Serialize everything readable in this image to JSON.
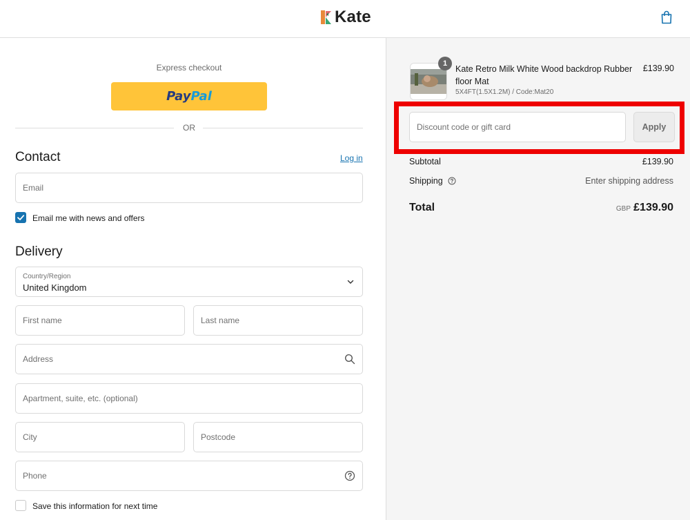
{
  "header": {
    "logo_text": "Kate",
    "cart_icon": "shopping-bag-icon"
  },
  "express": {
    "label": "Express checkout",
    "paypal_part1": "Pay",
    "paypal_part2": "Pal",
    "paypal_color": "#ffc439",
    "or_text": "OR"
  },
  "contact": {
    "heading": "Contact",
    "login_link": "Log in",
    "email_placeholder": "Email",
    "newsletter_label": "Email me with news and offers",
    "newsletter_checked": true
  },
  "delivery": {
    "heading": "Delivery",
    "country_label": "Country/Region",
    "country_value": "United Kingdom",
    "first_name_placeholder": "First name",
    "last_name_placeholder": "Last name",
    "address_placeholder": "Address",
    "apartment_placeholder": "Apartment, suite, etc. (optional)",
    "city_placeholder": "City",
    "postcode_placeholder": "Postcode",
    "phone_placeholder": "Phone",
    "save_info_label": "Save this information for next time",
    "save_info_checked": false
  },
  "order": {
    "item": {
      "quantity": "1",
      "title": "Kate Retro Milk White Wood backdrop Rubber floor Mat",
      "variant": "5X4FT(1.5X1.2M) / Code:Mat20",
      "price": "£139.90"
    },
    "discount_placeholder": "Discount code or gift card",
    "apply_label": "Apply",
    "subtotal_label": "Subtotal",
    "subtotal_value": "£139.90",
    "shipping_label": "Shipping",
    "shipping_value": "Enter shipping address",
    "total_label": "Total",
    "total_currency": "GBP",
    "total_value": "£139.90"
  },
  "colors": {
    "accent": "#1773b0",
    "highlight": "#ee0000",
    "summary_bg": "#f5f5f5"
  }
}
